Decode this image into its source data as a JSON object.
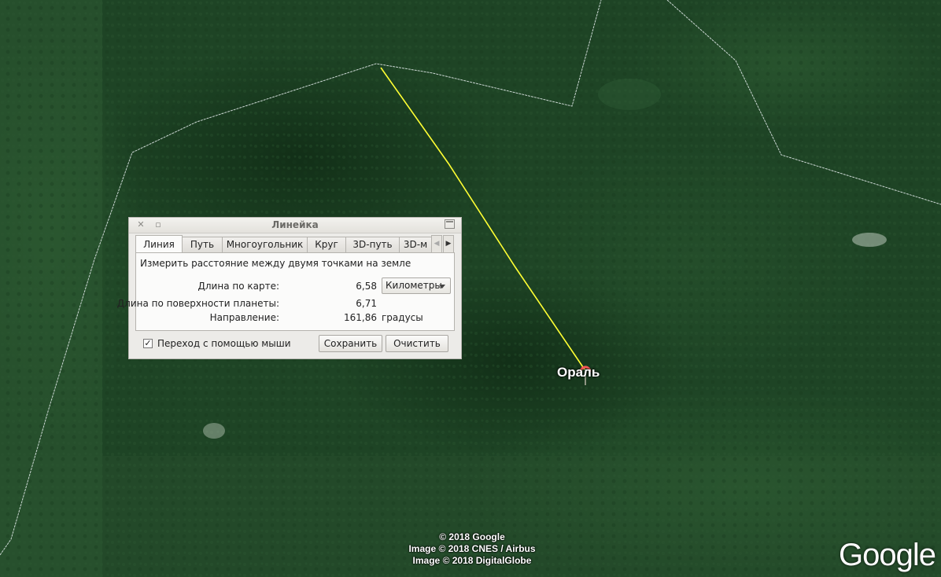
{
  "map": {
    "place_label": "Ораль",
    "attribution": [
      "© 2018 Google",
      "Image © 2018 CNES / Airbus",
      "Image © 2018 DigitalGlobe"
    ],
    "logo": "Google",
    "colors": {
      "forest": "#1f4526",
      "border": "#e8eef0",
      "measure_line": "#ffff33"
    }
  },
  "ruler": {
    "title": "Линейка",
    "tabs": [
      "Линия",
      "Путь",
      "Многоугольник",
      "Круг",
      "3D-путь",
      "3D-м"
    ],
    "active_tab": "Линия",
    "description": "Измерить расстояние между двумя точками на земле",
    "map_length": {
      "label": "Длина по карте:",
      "value": "6,58",
      "unit_selected": "Километры"
    },
    "ground_length": {
      "label": "Длина по поверхности планеты:",
      "value": "6,71"
    },
    "heading": {
      "label": "Направление:",
      "value": "161,86",
      "unit": "градусы"
    },
    "mouse_nav": {
      "label": "Переход с помощью мыши",
      "checked": true,
      "check_glyph": "✓"
    },
    "save_button": "Сохранить",
    "clear_button": "Очистить"
  }
}
